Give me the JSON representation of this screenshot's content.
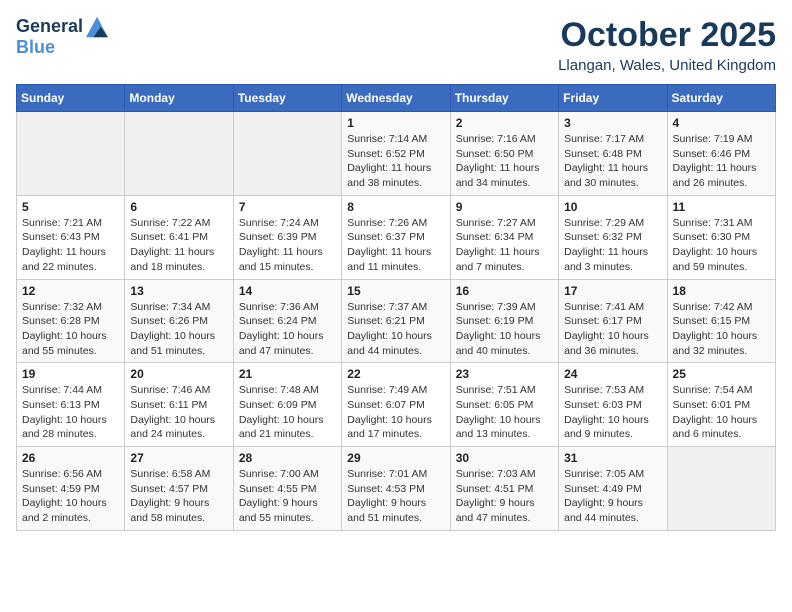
{
  "header": {
    "logo_line1": "General",
    "logo_line2": "Blue",
    "month_title": "October 2025",
    "location": "Llangan, Wales, United Kingdom"
  },
  "weekdays": [
    "Sunday",
    "Monday",
    "Tuesday",
    "Wednesday",
    "Thursday",
    "Friday",
    "Saturday"
  ],
  "weeks": [
    [
      {
        "day": "",
        "info": ""
      },
      {
        "day": "",
        "info": ""
      },
      {
        "day": "",
        "info": ""
      },
      {
        "day": "1",
        "info": "Sunrise: 7:14 AM\nSunset: 6:52 PM\nDaylight: 11 hours and 38 minutes."
      },
      {
        "day": "2",
        "info": "Sunrise: 7:16 AM\nSunset: 6:50 PM\nDaylight: 11 hours and 34 minutes."
      },
      {
        "day": "3",
        "info": "Sunrise: 7:17 AM\nSunset: 6:48 PM\nDaylight: 11 hours and 30 minutes."
      },
      {
        "day": "4",
        "info": "Sunrise: 7:19 AM\nSunset: 6:46 PM\nDaylight: 11 hours and 26 minutes."
      }
    ],
    [
      {
        "day": "5",
        "info": "Sunrise: 7:21 AM\nSunset: 6:43 PM\nDaylight: 11 hours and 22 minutes."
      },
      {
        "day": "6",
        "info": "Sunrise: 7:22 AM\nSunset: 6:41 PM\nDaylight: 11 hours and 18 minutes."
      },
      {
        "day": "7",
        "info": "Sunrise: 7:24 AM\nSunset: 6:39 PM\nDaylight: 11 hours and 15 minutes."
      },
      {
        "day": "8",
        "info": "Sunrise: 7:26 AM\nSunset: 6:37 PM\nDaylight: 11 hours and 11 minutes."
      },
      {
        "day": "9",
        "info": "Sunrise: 7:27 AM\nSunset: 6:34 PM\nDaylight: 11 hours and 7 minutes."
      },
      {
        "day": "10",
        "info": "Sunrise: 7:29 AM\nSunset: 6:32 PM\nDaylight: 11 hours and 3 minutes."
      },
      {
        "day": "11",
        "info": "Sunrise: 7:31 AM\nSunset: 6:30 PM\nDaylight: 10 hours and 59 minutes."
      }
    ],
    [
      {
        "day": "12",
        "info": "Sunrise: 7:32 AM\nSunset: 6:28 PM\nDaylight: 10 hours and 55 minutes."
      },
      {
        "day": "13",
        "info": "Sunrise: 7:34 AM\nSunset: 6:26 PM\nDaylight: 10 hours and 51 minutes."
      },
      {
        "day": "14",
        "info": "Sunrise: 7:36 AM\nSunset: 6:24 PM\nDaylight: 10 hours and 47 minutes."
      },
      {
        "day": "15",
        "info": "Sunrise: 7:37 AM\nSunset: 6:21 PM\nDaylight: 10 hours and 44 minutes."
      },
      {
        "day": "16",
        "info": "Sunrise: 7:39 AM\nSunset: 6:19 PM\nDaylight: 10 hours and 40 minutes."
      },
      {
        "day": "17",
        "info": "Sunrise: 7:41 AM\nSunset: 6:17 PM\nDaylight: 10 hours and 36 minutes."
      },
      {
        "day": "18",
        "info": "Sunrise: 7:42 AM\nSunset: 6:15 PM\nDaylight: 10 hours and 32 minutes."
      }
    ],
    [
      {
        "day": "19",
        "info": "Sunrise: 7:44 AM\nSunset: 6:13 PM\nDaylight: 10 hours and 28 minutes."
      },
      {
        "day": "20",
        "info": "Sunrise: 7:46 AM\nSunset: 6:11 PM\nDaylight: 10 hours and 24 minutes."
      },
      {
        "day": "21",
        "info": "Sunrise: 7:48 AM\nSunset: 6:09 PM\nDaylight: 10 hours and 21 minutes."
      },
      {
        "day": "22",
        "info": "Sunrise: 7:49 AM\nSunset: 6:07 PM\nDaylight: 10 hours and 17 minutes."
      },
      {
        "day": "23",
        "info": "Sunrise: 7:51 AM\nSunset: 6:05 PM\nDaylight: 10 hours and 13 minutes."
      },
      {
        "day": "24",
        "info": "Sunrise: 7:53 AM\nSunset: 6:03 PM\nDaylight: 10 hours and 9 minutes."
      },
      {
        "day": "25",
        "info": "Sunrise: 7:54 AM\nSunset: 6:01 PM\nDaylight: 10 hours and 6 minutes."
      }
    ],
    [
      {
        "day": "26",
        "info": "Sunrise: 6:56 AM\nSunset: 4:59 PM\nDaylight: 10 hours and 2 minutes."
      },
      {
        "day": "27",
        "info": "Sunrise: 6:58 AM\nSunset: 4:57 PM\nDaylight: 9 hours and 58 minutes."
      },
      {
        "day": "28",
        "info": "Sunrise: 7:00 AM\nSunset: 4:55 PM\nDaylight: 9 hours and 55 minutes."
      },
      {
        "day": "29",
        "info": "Sunrise: 7:01 AM\nSunset: 4:53 PM\nDaylight: 9 hours and 51 minutes."
      },
      {
        "day": "30",
        "info": "Sunrise: 7:03 AM\nSunset: 4:51 PM\nDaylight: 9 hours and 47 minutes."
      },
      {
        "day": "31",
        "info": "Sunrise: 7:05 AM\nSunset: 4:49 PM\nDaylight: 9 hours and 44 minutes."
      },
      {
        "day": "",
        "info": ""
      }
    ]
  ]
}
